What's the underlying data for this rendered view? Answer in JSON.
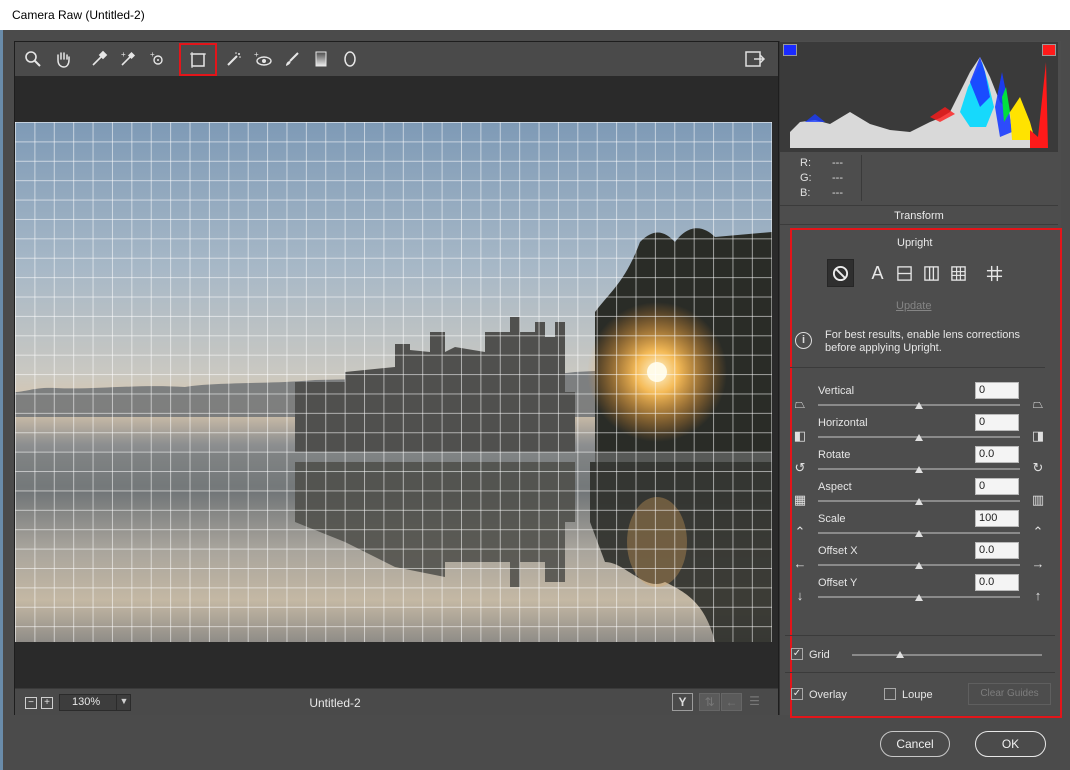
{
  "window": {
    "title": "Camera Raw (Untitled-2)"
  },
  "toolbar": {
    "tools": [
      {
        "name": "zoom-tool",
        "icon": "magnifier-icon"
      },
      {
        "name": "hand-tool",
        "icon": "hand-icon"
      },
      {
        "name": "white-balance-tool",
        "icon": "eyedropper-icon"
      },
      {
        "name": "color-sampler-tool",
        "icon": "color-sampler-icon"
      },
      {
        "name": "targeted-adjustment-tool",
        "icon": "target-adjust-icon"
      },
      {
        "name": "transform-tool",
        "icon": "transform-icon",
        "active": true
      },
      {
        "name": "spot-removal-tool",
        "icon": "spot-removal-icon"
      },
      {
        "name": "red-eye-tool",
        "icon": "red-eye-icon"
      },
      {
        "name": "adjustment-brush-tool",
        "icon": "brush-icon"
      },
      {
        "name": "graduated-filter-tool",
        "icon": "gradient-icon"
      },
      {
        "name": "radial-filter-tool",
        "icon": "radial-icon"
      }
    ]
  },
  "status": {
    "zoom_minus": "−",
    "zoom_plus": "+",
    "zoom_value": "130%",
    "filename": "Untitled-2",
    "before_after_label": "Y"
  },
  "histogram": {
    "r_label": "R:",
    "g_label": "G:",
    "b_label": "B:",
    "r_value": "---",
    "g_value": "---",
    "b_value": "---"
  },
  "panel": {
    "title": "Transform",
    "upright_label": "Upright",
    "upright_modes": [
      {
        "name": "upright-off",
        "icon": "no-symbol-icon",
        "active": true
      },
      {
        "name": "upright-auto",
        "icon": "auto-a-icon"
      },
      {
        "name": "upright-level",
        "icon": "level-icon"
      },
      {
        "name": "upright-vertical",
        "icon": "vertical-icon"
      },
      {
        "name": "upright-full",
        "icon": "full-grid-icon"
      },
      {
        "name": "upright-guided",
        "icon": "guided-icon"
      }
    ],
    "update_label": "Update",
    "info_text": "For best results, enable lens corrections before applying Upright.",
    "sliders": [
      {
        "key": "vertical",
        "label": "Vertical",
        "value": "0",
        "position": 0.5
      },
      {
        "key": "horizontal",
        "label": "Horizontal",
        "value": "0",
        "position": 0.5
      },
      {
        "key": "rotate",
        "label": "Rotate",
        "value": "0.0",
        "position": 0.5
      },
      {
        "key": "aspect",
        "label": "Aspect",
        "value": "0",
        "position": 0.5
      },
      {
        "key": "scale",
        "label": "Scale",
        "value": "100",
        "position": 0.5
      },
      {
        "key": "offset-x",
        "label": "Offset X",
        "value": "0.0",
        "position": 0.5
      },
      {
        "key": "offset-y",
        "label": "Offset Y",
        "value": "0.0",
        "position": 0.5
      }
    ],
    "grid_label": "Grid",
    "grid_checked": true,
    "grid_slider_position": 0.25,
    "overlay_label": "Overlay",
    "overlay_checked": true,
    "loupe_label": "Loupe",
    "loupe_checked": false,
    "clear_guides_label": "Clear Guides"
  },
  "dialog": {
    "cancel_label": "Cancel",
    "ok_label": "OK"
  },
  "colors": {
    "highlight": "#e3151a",
    "panel_bg": "#4d4d4d",
    "preview_bg": "#2a2a2a"
  }
}
